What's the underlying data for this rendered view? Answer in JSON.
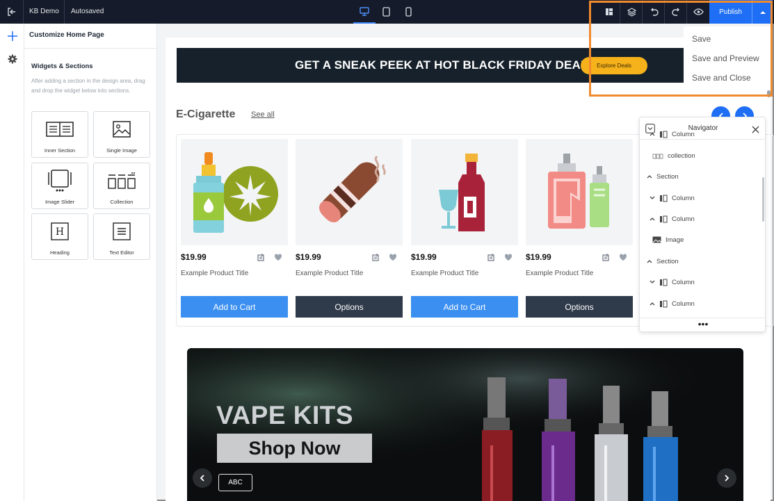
{
  "topbar": {
    "site_name": "KB Demo",
    "save_status": "Autosaved",
    "publish_label": "Publish"
  },
  "sidebar_panel": {
    "header": "Customize Home Page",
    "section_title": "Widgets & Sections",
    "description": "After adding a section in the design area, drag and drop the widget below into sections.",
    "widgets": [
      {
        "label": "Inner Section",
        "icon": "inner-section-icon"
      },
      {
        "label": "Single Image",
        "icon": "image-icon"
      },
      {
        "label": "Image Slider",
        "icon": "image-slider-icon"
      },
      {
        "label": "Collection",
        "icon": "collection-icon"
      },
      {
        "label": "Heading",
        "icon": "heading-icon"
      },
      {
        "label": "Text Editor",
        "icon": "text-editor-icon"
      }
    ]
  },
  "canvas": {
    "banner": {
      "text": "GET A SNEAK PEEK AT HOT BLACK FRIDAY DEALS!",
      "button": "Explore Deals"
    },
    "collection": {
      "title": "E-Cigarette",
      "see_all": "See all",
      "products": [
        {
          "price": "$19.99",
          "title": "Example Product Title",
          "button": "Add to Cart",
          "button_color": "#3b8ff0",
          "image": "e-liquid-cannabis"
        },
        {
          "price": "$19.99",
          "title": "Example Product Title",
          "button": "Options",
          "button_color": "#2f3a4a",
          "image": "cigar"
        },
        {
          "price": "$19.99",
          "title": "Example Product Title",
          "button": "Add to Cart",
          "button_color": "#3b8ff0",
          "image": "wine-bottle"
        },
        {
          "price": "$19.99",
          "title": "Example Product Title",
          "button": "Options",
          "button_color": "#2f3a4a",
          "image": "vape-devices"
        }
      ]
    },
    "hero": {
      "title": "VAPE KITS",
      "cta": "Shop Now",
      "tag": "ABC"
    }
  },
  "navigator": {
    "title": "Navigator",
    "items": [
      {
        "label": "Column",
        "type": "column",
        "chevron": "up"
      },
      {
        "label": "collection",
        "type": "collection",
        "chevron": ""
      },
      {
        "label": "Section",
        "type": "section",
        "chevron": "up"
      },
      {
        "label": "Column",
        "type": "column",
        "chevron": "down"
      },
      {
        "label": "Column",
        "type": "column",
        "chevron": "up"
      },
      {
        "label": "Image",
        "type": "image",
        "chevron": ""
      },
      {
        "label": "Section",
        "type": "section",
        "chevron": "up"
      },
      {
        "label": "Column",
        "type": "column",
        "chevron": "down"
      },
      {
        "label": "Column",
        "type": "column",
        "chevron": "up"
      }
    ],
    "more": "•••"
  },
  "publish_menu": {
    "items": [
      "Save",
      "Save and Preview",
      "Save and Close"
    ]
  },
  "colors": {
    "topbar": "#151b2b",
    "accent": "#1e6ff5",
    "highlight": "#f08a2e"
  }
}
